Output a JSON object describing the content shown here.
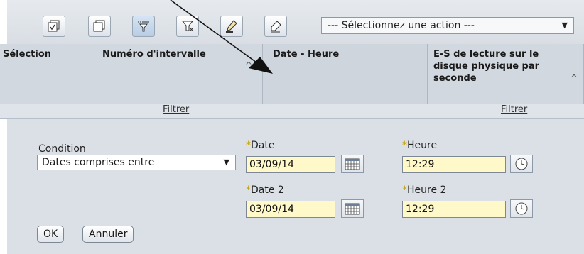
{
  "toolbar": {
    "buttons": [
      {
        "icon": "select-all-icon"
      },
      {
        "icon": "deselect-all-icon"
      },
      {
        "icon": "show-filter-row-icon"
      },
      {
        "icon": "clear-filters-icon"
      },
      {
        "icon": "edit-sort-icon"
      },
      {
        "icon": "clear-sort-icon"
      }
    ],
    "action_select": "--- Sélectionnez une action ---"
  },
  "table": {
    "columns": [
      {
        "label": "Sélection"
      },
      {
        "label": "Numéro d'intervalle"
      },
      {
        "label": "Date - Heure"
      },
      {
        "label": "E-S de lecture sur le disque physique par seconde"
      }
    ],
    "filter_label": "Filtrer"
  },
  "filter_form": {
    "condition_label": "Condition",
    "condition_value": "Dates comprises entre",
    "date_label": "Date",
    "date_value": "03/09/14",
    "time_label": "Heure",
    "time_value": "12:29",
    "date2_label": "Date 2",
    "date2_value": "03/09/14",
    "time2_label": "Heure 2",
    "time2_value": "12:29",
    "required_marker": "*",
    "ok_label": "OK",
    "cancel_label": "Annuler"
  }
}
